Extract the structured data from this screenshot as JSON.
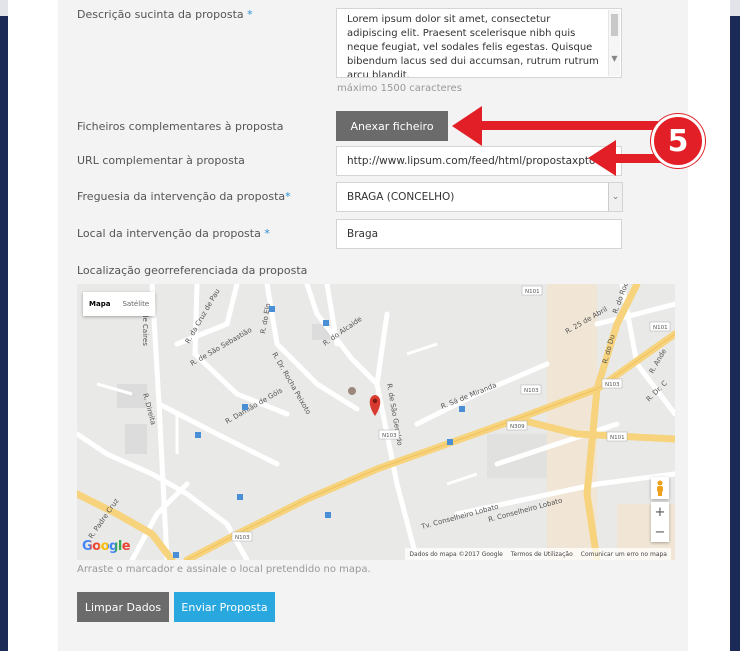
{
  "form": {
    "description": {
      "label": "Descrição sucinta da proposta",
      "required_mark": "*",
      "value": "Lorem ipsum dolor sit amet, consectetur adipiscing elit. Praesent scelerisque nibh quis neque feugiat, vel sodales felis egestas. Quisque bibendum lacus sed dui accumsan, rutrum rutrum arcu blandit.",
      "hint": "máximo 1500 caracteres"
    },
    "files": {
      "label": "Ficheiros complementares à proposta",
      "button": "Anexar ficheiro"
    },
    "url": {
      "label": "URL complementar à proposta",
      "value": "http://www.lipsum.com/feed/html/propostaxpto"
    },
    "parish": {
      "label": "Freguesia da intervenção da proposta",
      "required_mark": "*",
      "value": "BRAGA (CONCELHO)"
    },
    "location": {
      "label": "Local da intervenção da proposta",
      "required_mark": "*",
      "value": "Braga"
    },
    "georef": {
      "label": "Localização georreferenciada da proposta"
    },
    "map_note": "Arraste o marcador e assinale o local pretendido no mapa.",
    "clear_button": "Limpar Dados",
    "submit_button": "Enviar Proposta"
  },
  "map": {
    "tab_map": "Mapa",
    "tab_satellite": "Satélite",
    "google": "Google",
    "footer_data": "Dados do mapa ©2017 Google",
    "footer_terms": "Termos de Utilização",
    "footer_report": "Comunicar um erro no mapa",
    "zoom_in": "+",
    "zoom_out": "−",
    "streets": {
      "caires": "R. de Caires",
      "cruz_pau": "R. da Cruz de Pau",
      "sao_sebastiao": "R. de São Sebastião",
      "direita": "R. Direita",
      "alcaide": "R. do Alcaide",
      "elo": "R. do Elo",
      "rocha_peixoto": "R. Dr. Rocha Peixoto",
      "damiao": "R. Damião de Góis",
      "sao_geraldo": "R. de São Geraldo",
      "sa_miranda": "R. Sá de Miranda",
      "abril": "R. 25 de Abril",
      "padre_cruz": "R. Padre Cruz",
      "lobato_tv": "Tv. Conselheiro Lobato",
      "lobato": "R. Conselheiro Lobato",
      "do_du": "R. do Du",
      "dr_c": "R. Dr. C",
      "rocha": "R. do Rocha",
      "ande": "R. Ande"
    },
    "road_labels": {
      "n101_a": "N101",
      "n101_b": "N101",
      "n103_a": "N103",
      "n103_b": "N103",
      "n103_c": "N103",
      "n103_d": "N103",
      "n309": "N309",
      "n101_c": "N101"
    }
  },
  "annotation": {
    "number": "5"
  },
  "colors": {
    "accent_blue": "#29a8e0",
    "button_gray": "#6b6b6b",
    "annotation_red": "#e21f26",
    "marker_red": "#d93a2f",
    "road_yellow": "#f6d37c"
  }
}
